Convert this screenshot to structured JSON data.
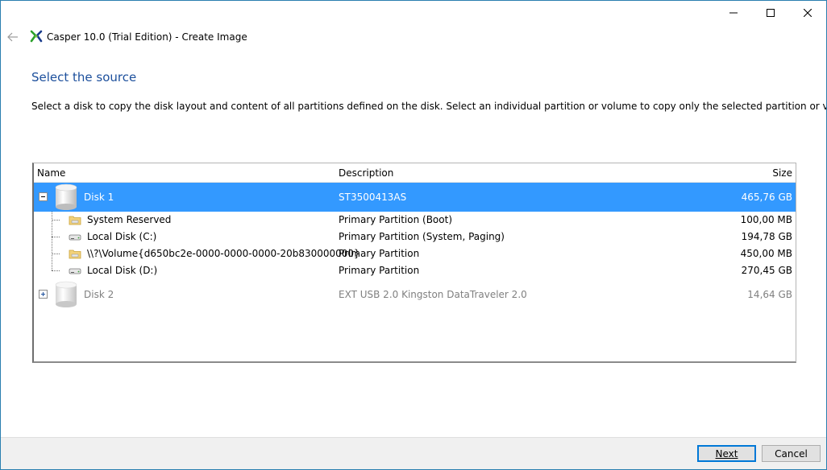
{
  "window": {
    "title": "Casper 10.0 (Trial Edition) - Create Image",
    "controls": {
      "minimize": "minimize-icon",
      "maximize": "maximize-icon",
      "close": "close-icon"
    }
  },
  "page": {
    "heading": "Select the source",
    "instructions": "Select a disk to copy the disk layout and content of all partitions defined on the disk. Select an individual partition or volume to copy only the selected partition or volume."
  },
  "tree": {
    "columns": {
      "name": "Name",
      "description": "Description",
      "size": "Size"
    },
    "rows": [
      {
        "type": "disk",
        "name": "Disk 1",
        "description": "ST3500413AS",
        "size": "465,76 GB",
        "expanded": true,
        "selected": true
      },
      {
        "type": "partition",
        "icon": "folder-drive-icon",
        "name": "System Reserved",
        "description": "Primary Partition (Boot)",
        "size": "100,00 MB"
      },
      {
        "type": "partition",
        "icon": "hard-drive-icon",
        "name": "Local Disk (C:)",
        "description": "Primary Partition (System, Paging)",
        "size": "194,78 GB"
      },
      {
        "type": "partition",
        "icon": "folder-drive-icon",
        "name": "\\\\?\\Volume{d650bc2e-0000-0000-0000-20b830000000}",
        "description": "Primary Partition",
        "size": "450,00 MB"
      },
      {
        "type": "partition",
        "icon": "hard-drive-icon",
        "name": "Local Disk (D:)",
        "description": "Primary Partition",
        "size": "270,45 GB"
      },
      {
        "type": "disk",
        "name": "Disk 2",
        "description": "EXT USB 2.0 Kingston DataTraveler 2.0",
        "size": "14,64 GB",
        "expanded": false,
        "selected": false,
        "dim": true
      }
    ]
  },
  "footer": {
    "next_label": "Next",
    "cancel_label": "Cancel"
  },
  "colors": {
    "accent": "#3399ff",
    "heading": "#1c4f9c",
    "default_button_border": "#0078d7"
  }
}
